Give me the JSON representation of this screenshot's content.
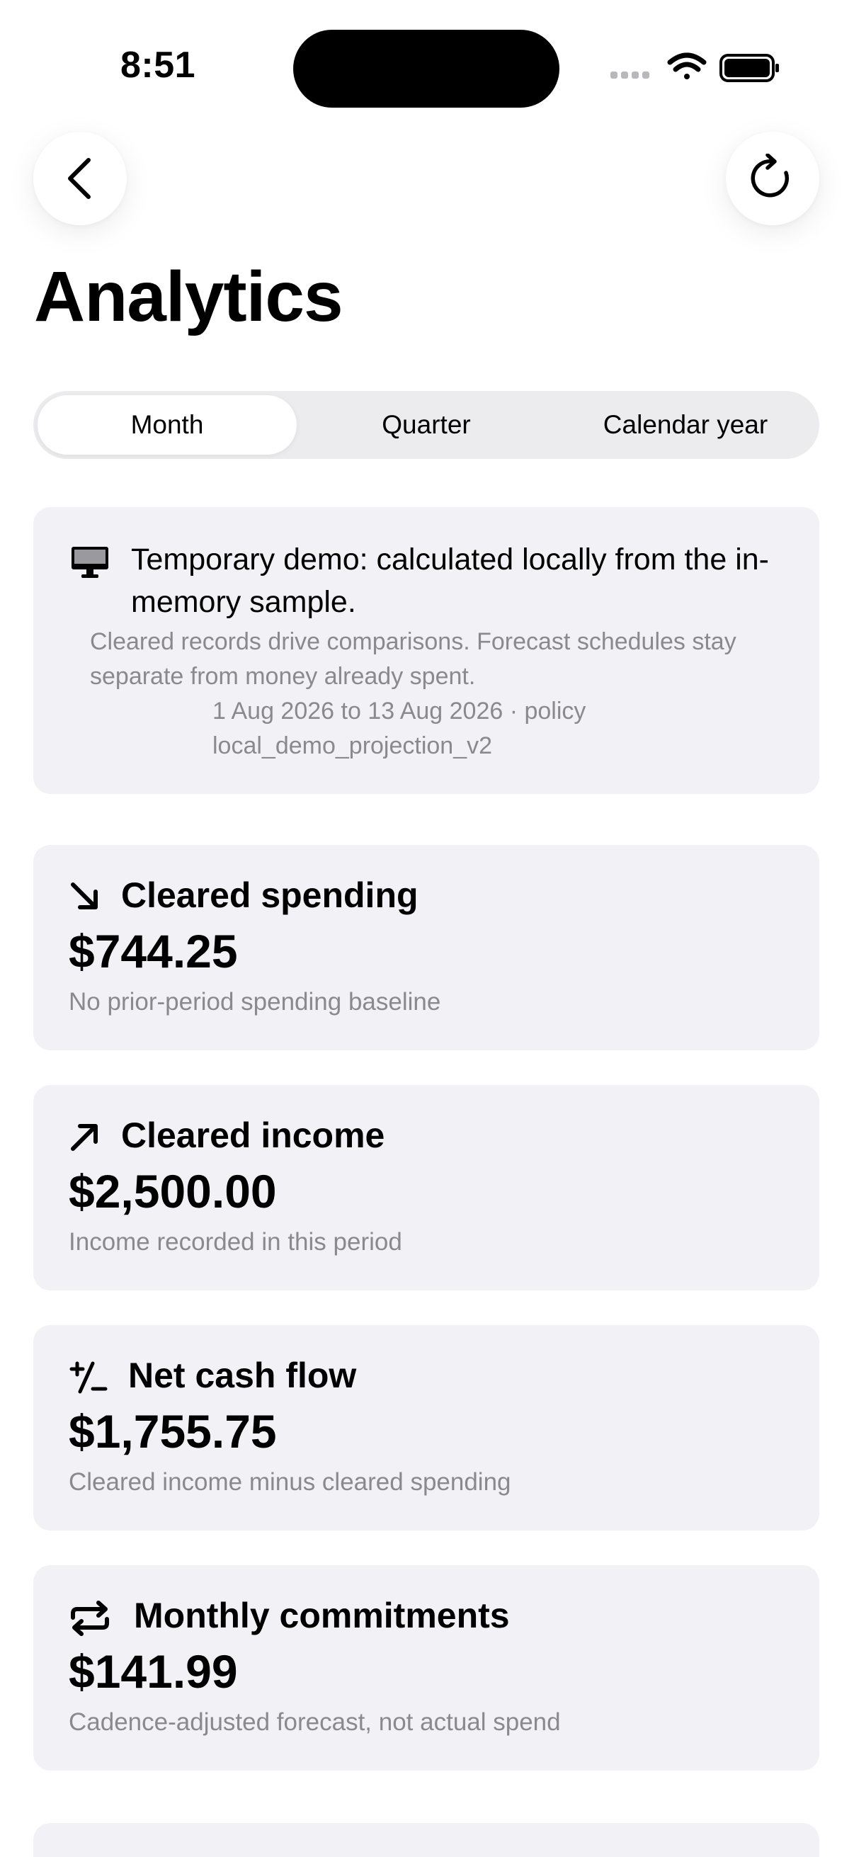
{
  "status": {
    "time": "8:51"
  },
  "header": {
    "title": "Analytics"
  },
  "segments": [
    {
      "label": "Month",
      "active": true
    },
    {
      "label": "Quarter",
      "active": false
    },
    {
      "label": "Calendar year",
      "active": false
    }
  ],
  "notice": {
    "icon": "desktop-icon",
    "title": "Temporary demo: calculated locally from the in-memory sample.",
    "subtitle": "Cleared records drive comparisons. Forecast schedules stay separate from money already spent.",
    "range": "1 Aug 2026 to 13 Aug 2026 · policy local_demo_projection_v2"
  },
  "metrics": [
    {
      "icon": "arrow-down-right-icon",
      "title": "Cleared spending",
      "value": "$744.25",
      "subtitle": "No prior-period spending baseline"
    },
    {
      "icon": "arrow-up-right-icon",
      "title": "Cleared income",
      "value": "$2,500.00",
      "subtitle": "Income recorded in this period"
    },
    {
      "icon": "plus-minus-icon",
      "title": "Net cash flow",
      "value": "$1,755.75",
      "subtitle": "Cleared income minus cleared spending"
    },
    {
      "icon": "repeat-icon",
      "title": "Monthly commitments",
      "value": "$141.99",
      "subtitle": "Cadence-adjusted forecast, not actual spend"
    }
  ]
}
